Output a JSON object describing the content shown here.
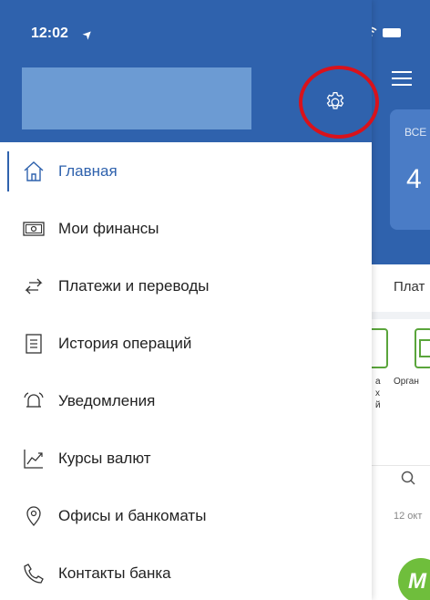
{
  "status_bar": {
    "time": "12:02",
    "location_arrow": "➤"
  },
  "drawer": {
    "settings_icon": "gear-icon",
    "menu": [
      {
        "label": "Главная",
        "icon": "home-icon",
        "active": true
      },
      {
        "label": "Мои финансы",
        "icon": "banknote-icon",
        "active": false
      },
      {
        "label": "Платежи и переводы",
        "icon": "transfer-arrows-icon",
        "active": false
      },
      {
        "label": "История операций",
        "icon": "document-list-icon",
        "active": false
      },
      {
        "label": "Уведомления",
        "icon": "bell-icon",
        "active": false
      },
      {
        "label": "Курсы валют",
        "icon": "chart-line-icon",
        "active": false
      },
      {
        "label": "Офисы и банкоматы",
        "icon": "location-pin-icon",
        "active": false
      },
      {
        "label": "Контакты банка",
        "icon": "phone-icon",
        "active": false
      }
    ]
  },
  "background_app": {
    "card_label": "ВСЕ",
    "card_amount": "4",
    "tab_label": "Плат",
    "tile_text_left": "а\nх\nй",
    "tile_text_right": "Орган",
    "date_label": "12 окт",
    "avatar_letter": "М"
  },
  "colors": {
    "brand_blue": "#2f62ad",
    "profile_placeholder": "#6c9bd3",
    "annotation_red": "#d9121b",
    "accent_green": "#6fbe3c"
  }
}
